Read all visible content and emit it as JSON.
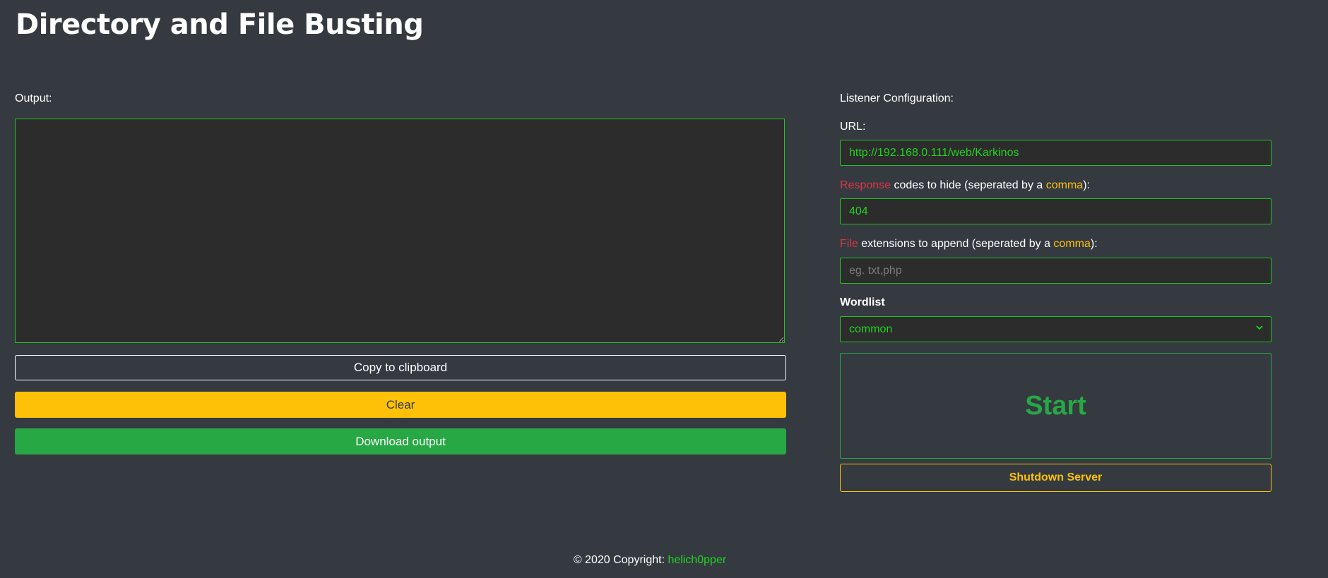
{
  "page": {
    "title": "Directory and File Busting"
  },
  "output": {
    "label": "Output:",
    "value": "",
    "copy_label": "Copy to clipboard",
    "clear_label": "Clear",
    "download_label": "Download output"
  },
  "config": {
    "heading": "Listener Configuration:",
    "url_label": "URL:",
    "url_value": "http://192.168.0.111/web/Karkinos",
    "response_label_red": "Response",
    "response_label_mid": " codes to hide (seperated by a ",
    "response_label_yellow": "comma",
    "response_label_end": "):",
    "response_value": "404",
    "ext_label_red": "File",
    "ext_label_mid": " extensions to append (seperated by a ",
    "ext_label_yellow": "comma",
    "ext_label_end": "):",
    "ext_placeholder": "eg. txt,php",
    "wordlist_label": "Wordlist",
    "wordlist_selected": "common",
    "start_label": "Start",
    "shutdown_label": "Shutdown Server"
  },
  "footer": {
    "copyright": "© 2020 Copyright: ",
    "author": "helich0pper"
  },
  "colors": {
    "background": "#343a40",
    "accent_green": "#22c322",
    "success": "#28a745",
    "warning": "#ffc107",
    "danger": "#dc3545"
  },
  "icons": {
    "select": "chevron-down-icon"
  }
}
